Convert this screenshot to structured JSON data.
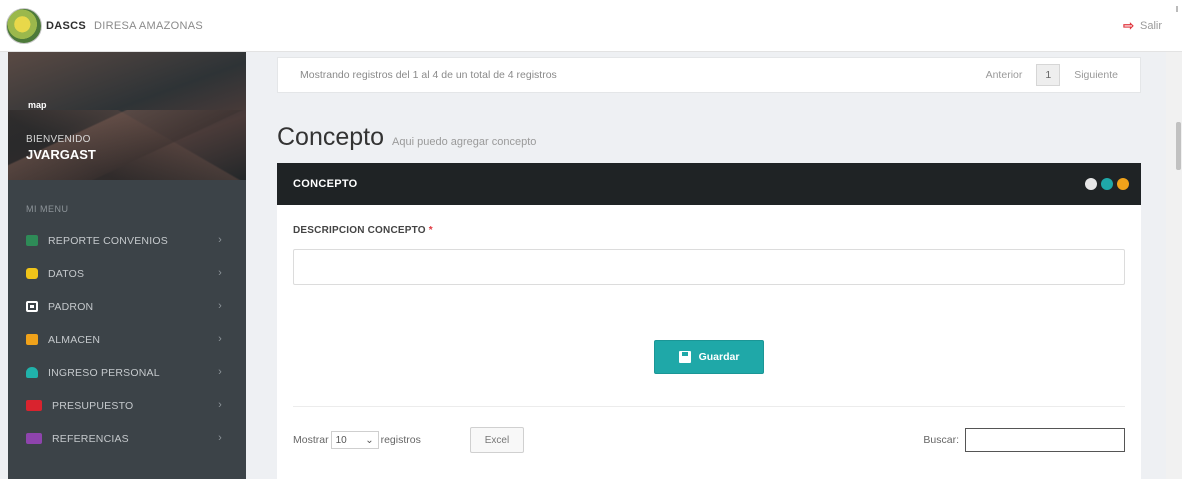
{
  "header": {
    "brand": "DASCS",
    "org": "DIRESA AMAZONAS",
    "logout_label": "Salir",
    "logout_icon": "sign-out-icon"
  },
  "sidebar": {
    "map_tag": "map",
    "welcome": "BIENVENIDO",
    "username": "JVARGAST",
    "menu_title": "MI MENU",
    "items": [
      {
        "label": "REPORTE CONVENIOS",
        "icon": "chart-icon",
        "color": "#2e8b57"
      },
      {
        "label": "DATOS",
        "icon": "database-icon",
        "color": "#f0c419"
      },
      {
        "label": "PADRON",
        "icon": "table-icon",
        "color": "#ffffff"
      },
      {
        "label": "ALMACEN",
        "icon": "cubes-icon",
        "color": "#f0a21a"
      },
      {
        "label": "INGRESO PERSONAL",
        "icon": "user-plus-icon",
        "color": "#20b2aa"
      },
      {
        "label": "PRESUPUESTO",
        "icon": "money-icon",
        "color": "#d9232e"
      },
      {
        "label": "REFERENCIAS",
        "icon": "list-icon",
        "color": "#8e44ad"
      }
    ]
  },
  "pager": {
    "info": "Mostrando registros del 1 al 4 de un total de 4 registros",
    "prev": "Anterior",
    "page": "1",
    "next": "Siguiente"
  },
  "page": {
    "title": "Concepto",
    "subtitle": "Aqui puedo agregar concepto"
  },
  "card": {
    "header": "CONCEPTO",
    "header_dot_colors": [
      "#e6e6e6",
      "#1fa8a8",
      "#f0a21a"
    ],
    "field_label": "DESCRIPCION CONCEPTO",
    "required_mark": "*",
    "field_value": "",
    "save_label": "Guardar",
    "save_icon": "floppy-disk-icon"
  },
  "table_controls": {
    "show_prefix": "Mostrar",
    "page_length": "10",
    "show_suffix": "registros",
    "excel_label": "Excel",
    "search_label": "Buscar:",
    "search_value": ""
  }
}
